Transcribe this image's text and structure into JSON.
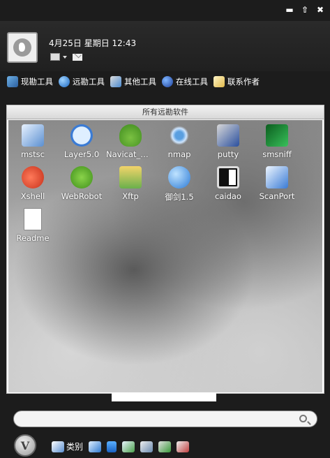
{
  "window": {
    "minimize_glyph": "▬",
    "pin_glyph": "⇧",
    "close_glyph": "✖"
  },
  "header": {
    "datetime": "4月25日 星期日 12:43"
  },
  "menu": {
    "items": [
      {
        "label": "现勘工具",
        "icon": "tools-icon"
      },
      {
        "label": "远勘工具",
        "icon": "globe-icon"
      },
      {
        "label": "其他工具",
        "icon": "misc-tools-icon"
      },
      {
        "label": "在线工具",
        "icon": "ie-icon"
      },
      {
        "label": "联系作者",
        "icon": "contact-icon"
      }
    ]
  },
  "panel": {
    "title": "所有远勘软件",
    "apps": [
      {
        "label": "mstsc",
        "icon": "remote-desktop-icon"
      },
      {
        "label": "Layer5.0",
        "icon": "layer-icon"
      },
      {
        "label": "Navicat_M...",
        "icon": "navicat-icon"
      },
      {
        "label": "nmap",
        "icon": "nmap-eye-icon"
      },
      {
        "label": "putty",
        "icon": "putty-icon"
      },
      {
        "label": "smsniff",
        "icon": "smsniff-icon"
      },
      {
        "label": "Xshell",
        "icon": "xshell-icon"
      },
      {
        "label": "WebRobot",
        "icon": "webrobot-icon"
      },
      {
        "label": "Xftp",
        "icon": "xftp-icon"
      },
      {
        "label": "御剑1.5",
        "icon": "yujian-icon"
      },
      {
        "label": "caidao",
        "icon": "caidao-icon"
      },
      {
        "label": "ScanPort",
        "icon": "scanport-icon"
      },
      {
        "label": "Readme",
        "icon": "document-icon"
      }
    ]
  },
  "search": {
    "value": "",
    "placeholder": ""
  },
  "bottom": {
    "logo_glyph": "V",
    "category_label": "类别"
  }
}
